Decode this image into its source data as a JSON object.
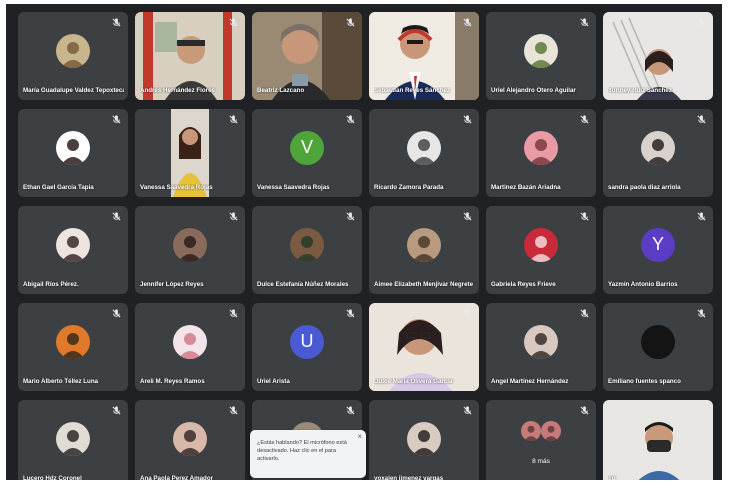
{
  "participants": [
    {
      "name": "María Guadalupe Valdez Tepoxtecatl",
      "kind": "photo",
      "colors": [
        "#c9b58c",
        "#7a5c3a"
      ]
    },
    {
      "name": "Andrés Hernández Flores",
      "kind": "video",
      "scene": "room-red"
    },
    {
      "name": "Beatriz Lazcano",
      "kind": "video",
      "scene": "woman"
    },
    {
      "name": "Sebastian Reyes Sánchez",
      "kind": "video",
      "scene": "headset"
    },
    {
      "name": "Uriel Alejandro Otero Aguilar",
      "kind": "photo",
      "colors": [
        "#e8e4d8",
        "#5a7a3a"
      ]
    },
    {
      "name": "Yuriney Ruiz Sánchez",
      "kind": "video",
      "scene": "stairs"
    },
    {
      "name": "Ethan Gael García Tapia",
      "kind": "photo",
      "colors": [
        "#ffffff",
        "#2b1c1c"
      ]
    },
    {
      "name": "Vanessa Saavedra Rojas",
      "kind": "video",
      "scene": "girl-yellow"
    },
    {
      "name": "Vanessa Saavedra Rojas",
      "kind": "letter",
      "letter": "V",
      "color": "#4fa53a"
    },
    {
      "name": "Ricardo Zamora Parada",
      "kind": "photo",
      "colors": [
        "#e6e6e6",
        "#444444"
      ]
    },
    {
      "name": "Martinez Bazán Ariadna",
      "kind": "photo",
      "colors": [
        "#e99aa4",
        "#7a3a40"
      ]
    },
    {
      "name": "sandra paola diaz arriola",
      "kind": "photo",
      "colors": [
        "#d9d2cc",
        "#2a2222"
      ]
    },
    {
      "name": "Abigail Ríos Pérez.",
      "kind": "photo",
      "colors": [
        "#ede4df",
        "#3a2a2a"
      ]
    },
    {
      "name": "Jennifer López Reyes",
      "kind": "photo",
      "colors": [
        "#8a6a5a",
        "#2a1e1e"
      ]
    },
    {
      "name": "Dulce Estefanía Núñez Morales",
      "kind": "photo",
      "colors": [
        "#7a5a40",
        "#2a3a2a"
      ]
    },
    {
      "name": "Aimee Elizabeth Menjivar Negrete",
      "kind": "photo",
      "colors": [
        "#b89a80",
        "#4a3a2a"
      ]
    },
    {
      "name": "Gabriela Reyes Frieve",
      "kind": "photo",
      "colors": [
        "#c82a3a",
        "#f0d8d8"
      ]
    },
    {
      "name": "Yazmín Antonio Barrios",
      "kind": "letter",
      "letter": "Y",
      "color": "#5b3cc4"
    },
    {
      "name": "Mario Alberto Téllez Luna",
      "kind": "photo",
      "colors": [
        "#e07a2a",
        "#3a2a1a"
      ]
    },
    {
      "name": "Areli M. Reyes Ramos",
      "kind": "photo",
      "colors": [
        "#f2e4e8",
        "#d27a8a"
      ]
    },
    {
      "name": "Uriel Arista",
      "kind": "letter",
      "letter": "U",
      "color": "#4a5ad4"
    },
    {
      "name": "Dulce María Olivera García",
      "kind": "video",
      "scene": "woman-glasses"
    },
    {
      "name": "Angel Martínez Hernández",
      "kind": "photo",
      "colors": [
        "#d8c8c0",
        "#3a2e2a"
      ]
    },
    {
      "name": "Emiliano fuentes spanco",
      "kind": "photo",
      "colors": [
        "#141414",
        "#141414"
      ]
    },
    {
      "name": "Lucero Hdz Coronel",
      "kind": "photo",
      "colors": [
        "#e0dcd4",
        "#2a2a2a"
      ]
    },
    {
      "name": "Ana Paola Perez Amador",
      "kind": "photo",
      "colors": [
        "#d8b8a8",
        "#3a2a2a"
      ]
    },
    {
      "name": "",
      "kind": "photo",
      "colors": [
        "#9a8a7a",
        "#3a2a2a"
      ]
    },
    {
      "name": "yoxalen jimenez vargas",
      "kind": "photo",
      "colors": [
        "#d8ccc0",
        "#2a2222"
      ]
    },
    {
      "name": "8 más",
      "kind": "more",
      "colors": [
        "#c87a7a",
        "#5a3a3a"
      ]
    },
    {
      "name": "Tú",
      "kind": "video",
      "scene": "self-mask"
    }
  ],
  "toast": {
    "text": "¿Estás hablando? El micrófono está desactivado. Haz clic en el para activarlo.",
    "close": "×"
  }
}
